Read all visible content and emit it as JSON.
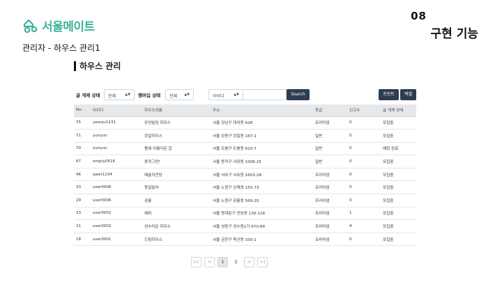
{
  "brand": {
    "name": "서울메이트"
  },
  "page_subtitle": "관리자 - 하우스 관리1",
  "badge": {
    "number": "08",
    "title": "구현 기능"
  },
  "section_title": "하우스 관리",
  "filters": {
    "post_status_label": "글 게재 상태",
    "post_status_value": "전체",
    "membership_label": "멤버십 상태",
    "membership_value": "전체",
    "search_field_value": "아이디",
    "search_placeholder": "",
    "search_button": "Search",
    "print_button": "프린트",
    "excel_button": "엑셀"
  },
  "table": {
    "headers": [
      "No.",
      "아이디",
      "하우스이름",
      "주소",
      "등급",
      "신고수",
      "글 게재 상태"
    ],
    "rows": [
      [
        "75",
        "yeonju1231",
        "우엉빌딩 하우스",
        "서울 강남구 대치동 628",
        "프리미엄",
        "0",
        "모집중"
      ],
      [
        "71",
        "yunyun",
        "강일하우스",
        "서울 강동구 강일동 167-1",
        "일반",
        "0",
        "모집중"
      ],
      [
        "70",
        "yunyun",
        "봄에 아름다운 집",
        "서울 도봉구 도봉동 610-7",
        "일반",
        "0",
        "매칭 완료"
      ],
      [
        "67",
        "empty0516",
        "동작그만!",
        "서울 동작구 사당동 1006-25",
        "일반",
        "0",
        "모집중"
      ],
      [
        "46",
        "qwer1234",
        "예술의전당",
        "서울 서초구 서초동 1603-28",
        "프리미엄",
        "0",
        "모집중"
      ],
      [
        "33",
        "user0006",
        "동일빌라",
        "서울 노원구 상계동 155-73",
        "프리미엄",
        "0",
        "모집중"
      ],
      [
        "29",
        "user0006",
        "공릉",
        "서울 노원구 공릉동 569-20",
        "프리미엄",
        "0",
        "모집중"
      ],
      [
        "23",
        "user0002",
        "해피",
        "서울 동대문구 전농동 130-128",
        "프리미엄",
        "1",
        "모집중"
      ],
      [
        "21",
        "user0002",
        "성수러운 하우스",
        "서울 성동구 성수동1가 670-84",
        "프리미엄",
        "4",
        "모집중"
      ],
      [
        "18",
        "user0001",
        "드림하우스",
        "서울 금천구 독산동 330-1",
        "프리미엄",
        "0",
        "모집중"
      ]
    ]
  },
  "pagination": {
    "first": "|<",
    "prev": "<",
    "pages": [
      "1",
      "2"
    ],
    "next": ">",
    "last": ">|"
  },
  "colors": {
    "brand": "#3bb39b",
    "button_dark": "#2f3d53",
    "highlight": "#f5ef3a"
  }
}
